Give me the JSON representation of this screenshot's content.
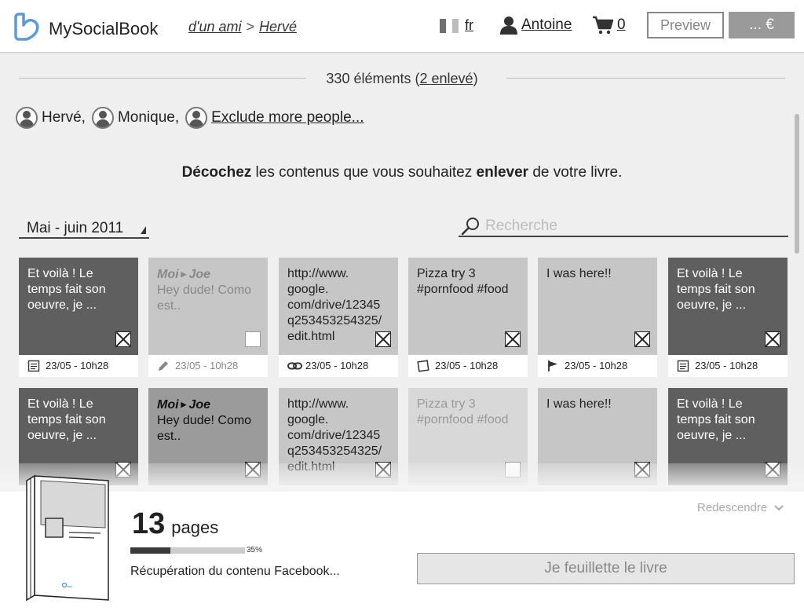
{
  "header": {
    "logo_text": "MySocialBook",
    "breadcrumb": {
      "link1": "d'un ami",
      "separator": ">",
      "link2": "Hervé"
    },
    "lang": "fr",
    "user": "Antoine",
    "cart_count": "0",
    "preview_label": "Preview",
    "price_label": "... €"
  },
  "counter": {
    "text": "330 éléments (",
    "link": "2 enlevé",
    "close": ")"
  },
  "people": [
    {
      "name": "Hervé,"
    },
    {
      "name": "Monique,"
    }
  ],
  "exclude_link": "Exclude more people...",
  "instruction": {
    "b1": "Décochez",
    "t1": " les contenus que vous souhaitez ",
    "b2": "enlever",
    "t2": " de votre livre."
  },
  "date_select": "Mai - juin 2011",
  "search": {
    "placeholder": "Recherche"
  },
  "cards_row1": [
    {
      "text": "Et voilà ! Le temps fait son oeuvre, je ...",
      "date": "23/05 - 10h28"
    },
    {
      "author": "Moi",
      "recipient": "Joe",
      "text": "Hey dude! Como est..",
      "date": "23/05 - 10h28"
    },
    {
      "text": "http://www. google. com/drive/12345 q253453254325/ edit.html",
      "date": "23/05 - 10h28"
    },
    {
      "text": "Pizza try 3 #pornfood #food",
      "date": "23/05 - 10h28"
    },
    {
      "text": "I was here!!",
      "date": "23/05 - 10h28"
    },
    {
      "text": "Et voilà ! Le temps fait son oeuvre, je ...",
      "date": "23/05 - 10h28"
    }
  ],
  "cards_row2": [
    {
      "text": "Et voilà ! Le temps fait son oeuvre, je ..."
    },
    {
      "author": "Moi",
      "recipient": "Joe",
      "text": "Hey dude! Como est.."
    },
    {
      "text": "http://www. google. com/drive/12345 q253453254325/ edit.html"
    },
    {
      "text": "Pizza try 3 #pornfood #food"
    },
    {
      "text": "I was here!!"
    },
    {
      "text": "Et voilà ! Le temps fait son oeuvre, je ..."
    }
  ],
  "bottom": {
    "pages_count": "13",
    "pages_label": "pages",
    "progress_percent": 35,
    "progress_label": "35%",
    "status": "Récupération du contenu Facebook...",
    "redescendre": "Redescendre",
    "flip_button": "Je feuillette le livre"
  },
  "colors": {
    "dark_card": "#5f5f5f",
    "mid_card": "#c6c6c6",
    "price_button": "#9a9a9a",
    "logo_blue": "#5b9bd5"
  }
}
